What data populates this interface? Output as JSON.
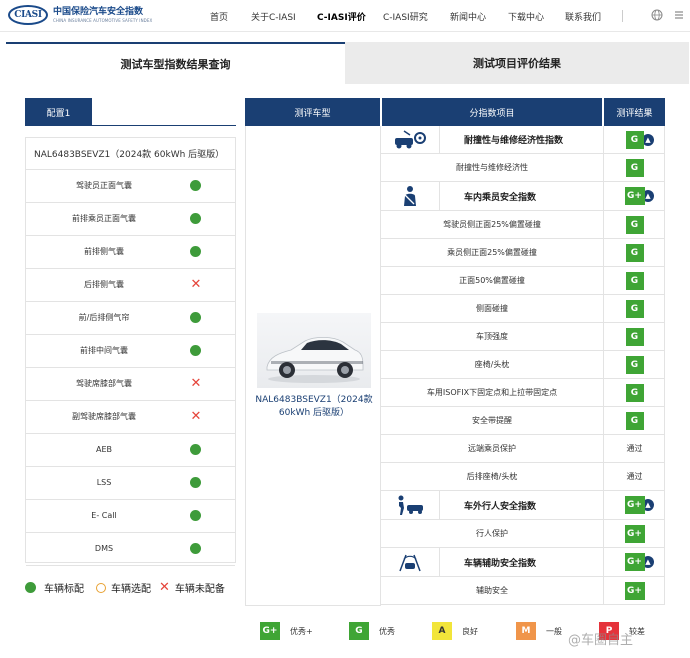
{
  "header": {
    "logo_mark": "CIASI",
    "logo_cn": "中国保险汽车安全指数",
    "logo_en": "CHINA INSURANCE AUTOMOTIVE SAFETY INDEX",
    "nav": [
      "首页",
      "关于C-IASI",
      "C-IASI评价",
      "C-IASI研究",
      "新闻中心",
      "下载中心",
      "联系我们"
    ],
    "icons": [
      "globe-icon",
      "menu-icon"
    ]
  },
  "tabs": {
    "query": "测试车型指数结果查询",
    "evaluation": "测试项目评价结果"
  },
  "config": {
    "title": "配置1",
    "model": "NAL6483BSEVZ1（2024款 60kWh 后驱版）",
    "items": [
      {
        "label": "驾驶员正面气囊",
        "status": "standard"
      },
      {
        "label": "前排乘员正面气囊",
        "status": "standard"
      },
      {
        "label": "前排侧气囊",
        "status": "standard"
      },
      {
        "label": "后排侧气囊",
        "status": "none"
      },
      {
        "label": "前/后排侧气帘",
        "status": "standard"
      },
      {
        "label": "前排中间气囊",
        "status": "standard"
      },
      {
        "label": "驾驶席膝部气囊",
        "status": "none"
      },
      {
        "label": "副驾驶席膝部气囊",
        "status": "none"
      },
      {
        "label": "AEB",
        "status": "standard"
      },
      {
        "label": "LSS",
        "status": "standard"
      },
      {
        "label": "E- Call",
        "status": "standard"
      },
      {
        "label": "DMS",
        "status": "standard"
      }
    ],
    "legend": {
      "standard": "车辆标配",
      "optional": "车辆选配",
      "none": "车辆未配备"
    }
  },
  "results": {
    "headers": {
      "model": "测评车型",
      "item": "分指数项目",
      "result": "测评结果"
    },
    "car_name": "NAL6483BSEVZ1（2024款 60kWh 后驱版）",
    "rows": [
      {
        "type": "cat",
        "name": "耐撞性与维修经济性指数",
        "icon": "repair-icon",
        "result": "G"
      },
      {
        "type": "item",
        "name": "耐撞性与维修经济性",
        "result": "G"
      },
      {
        "type": "cat",
        "name": "车内乘员安全指数",
        "icon": "occupant-icon",
        "result": "G+"
      },
      {
        "type": "item",
        "name": "驾驶员侧正面25%偏置碰撞",
        "result": "G"
      },
      {
        "type": "item",
        "name": "乘员侧正面25%偏置碰撞",
        "result": "G"
      },
      {
        "type": "item",
        "name": "正面50%偏置碰撞",
        "result": "G"
      },
      {
        "type": "item",
        "name": "侧面碰撞",
        "result": "G"
      },
      {
        "type": "item",
        "name": "车顶强度",
        "result": "G"
      },
      {
        "type": "item",
        "name": "座椅/头枕",
        "result": "G"
      },
      {
        "type": "item",
        "name": "车用ISOFIX下固定点和上拉带固定点",
        "result": "G"
      },
      {
        "type": "item",
        "name": "安全带提醒",
        "result": "G"
      },
      {
        "type": "item",
        "name": "远端乘员保护",
        "result": "通过"
      },
      {
        "type": "item",
        "name": "后排座椅/头枕",
        "result": "通过"
      },
      {
        "type": "cat",
        "name": "车外行人安全指数",
        "icon": "pedestrian-icon",
        "result": "G+"
      },
      {
        "type": "item",
        "name": "行人保护",
        "result": "G+"
      },
      {
        "type": "cat",
        "name": "车辆辅助安全指数",
        "icon": "assist-icon",
        "result": "G+"
      },
      {
        "type": "item",
        "name": "辅助安全",
        "result": "G+"
      }
    ]
  },
  "grade_legend": [
    {
      "badge": "G+",
      "label": "优秀+",
      "color": "#3fa535"
    },
    {
      "badge": "G",
      "label": "优秀",
      "color": "#3fa535"
    },
    {
      "badge": "A",
      "label": "良好",
      "color": "#f2e53a"
    },
    {
      "badge": "M",
      "label": "一般",
      "color": "#f0954a"
    },
    {
      "badge": "P",
      "label": "较差",
      "color": "#e5333b"
    }
  ],
  "watermark": "@车圈自主"
}
